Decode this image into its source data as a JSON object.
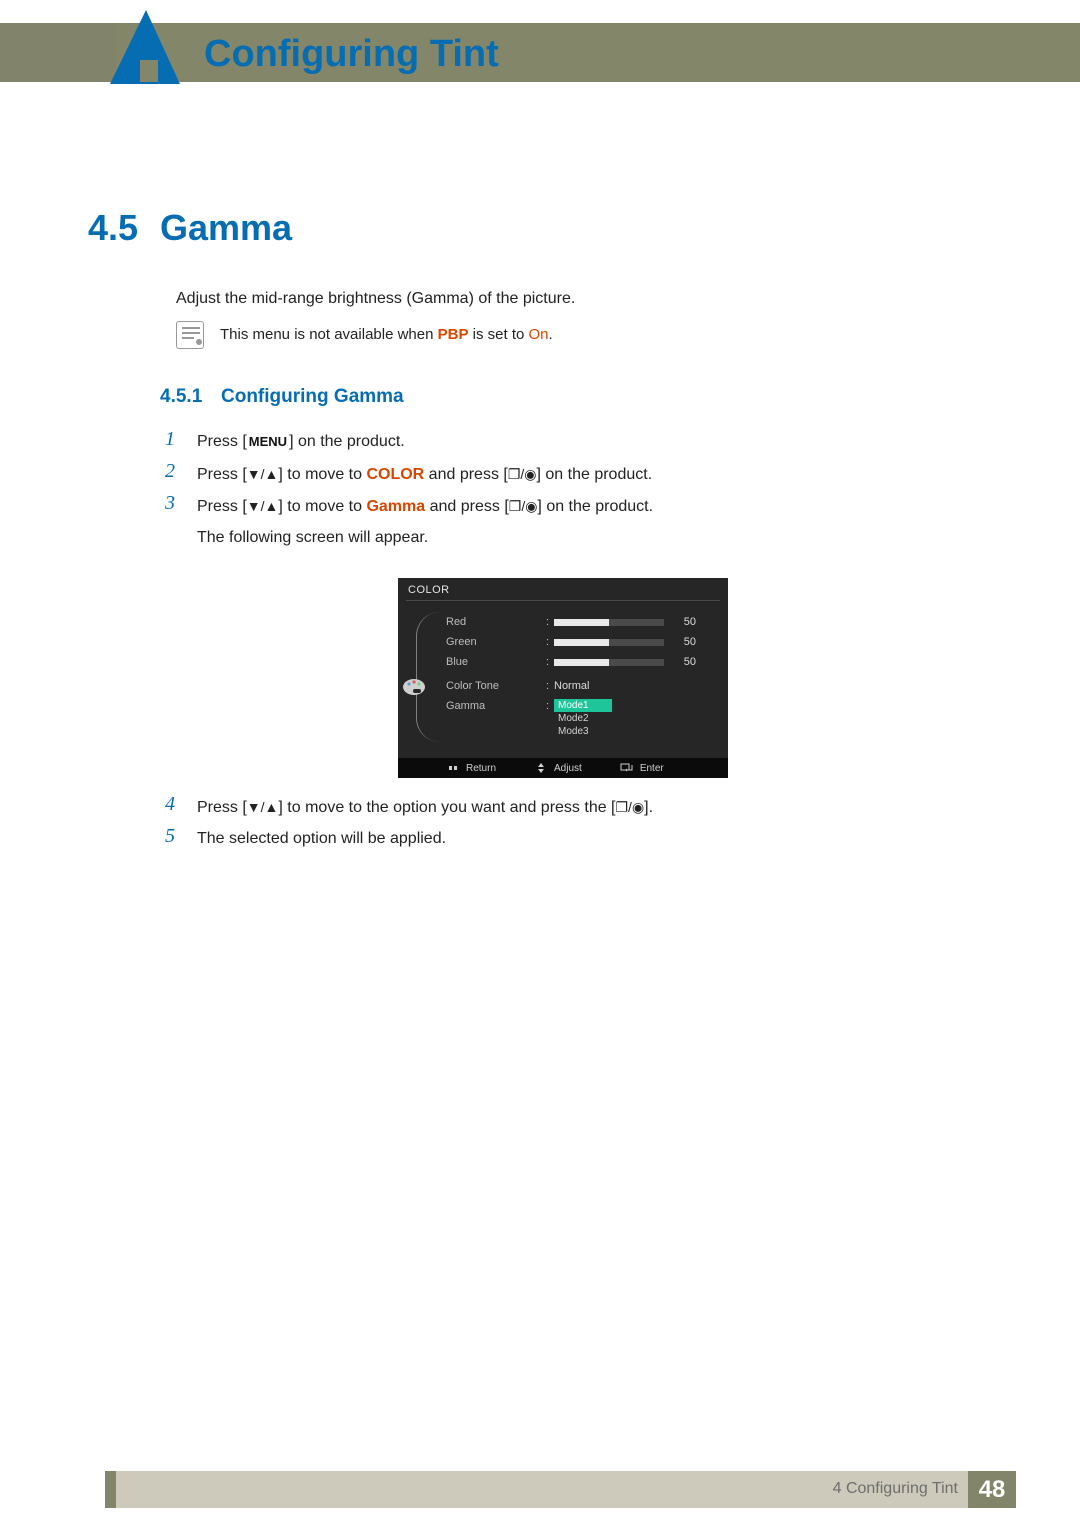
{
  "header": {
    "page_title": "Configuring Tint"
  },
  "section": {
    "number": "4.5",
    "title": "Gamma",
    "intro": "Adjust the mid-range brightness (Gamma) of the picture.",
    "note_pre": "This menu is not available when ",
    "note_pbp": "PBP",
    "note_mid": " is set to ",
    "note_on": "On",
    "note_post": "."
  },
  "subsection": {
    "number": "4.5.1",
    "title": "Configuring Gamma"
  },
  "steps": {
    "s1_num": "1",
    "s1_a": "Press [",
    "s1_menu": "MENU",
    "s1_b": "] on the product.",
    "s2_num": "2",
    "s2_a": "Press [",
    "s2_arrows": "▼/▲",
    "s2_b": "] to move to ",
    "s2_color": "COLOR",
    "s2_c": " and press [",
    "s2_enter": "❐/◉",
    "s2_d": "] on the product.",
    "s3_num": "3",
    "s3_a": "Press [",
    "s3_arrows": "▼/▲",
    "s3_b": "] to move to ",
    "s3_gamma": "Gamma",
    "s3_c": " and press [",
    "s3_enter": "❐/◉",
    "s3_d": "] on the product.",
    "s3_e": "The following screen will appear.",
    "s4_num": "4",
    "s4_a": "Press [",
    "s4_arrows": "▼/▲",
    "s4_b": "] to move to the option you want and press the [",
    "s4_enter": "❐/◉",
    "s4_c": "].",
    "s5_num": "5",
    "s5_a": "The selected option will be applied."
  },
  "osd": {
    "title": "COLOR",
    "rows": {
      "red": {
        "label": "Red",
        "value": "50",
        "fill_pct": 50
      },
      "green": {
        "label": "Green",
        "value": "50",
        "fill_pct": 50
      },
      "blue": {
        "label": "Blue",
        "value": "50",
        "fill_pct": 50
      },
      "ct": {
        "label": "Color Tone",
        "value": "Normal"
      },
      "gamma": {
        "label": "Gamma"
      }
    },
    "modes": {
      "m1": "Mode1",
      "m2": "Mode2",
      "m3": "Mode3"
    },
    "foot": {
      "return": "Return",
      "adjust": "Adjust",
      "enter": "Enter"
    }
  },
  "footer": {
    "chapter": "4 Configuring Tint",
    "page": "48"
  }
}
